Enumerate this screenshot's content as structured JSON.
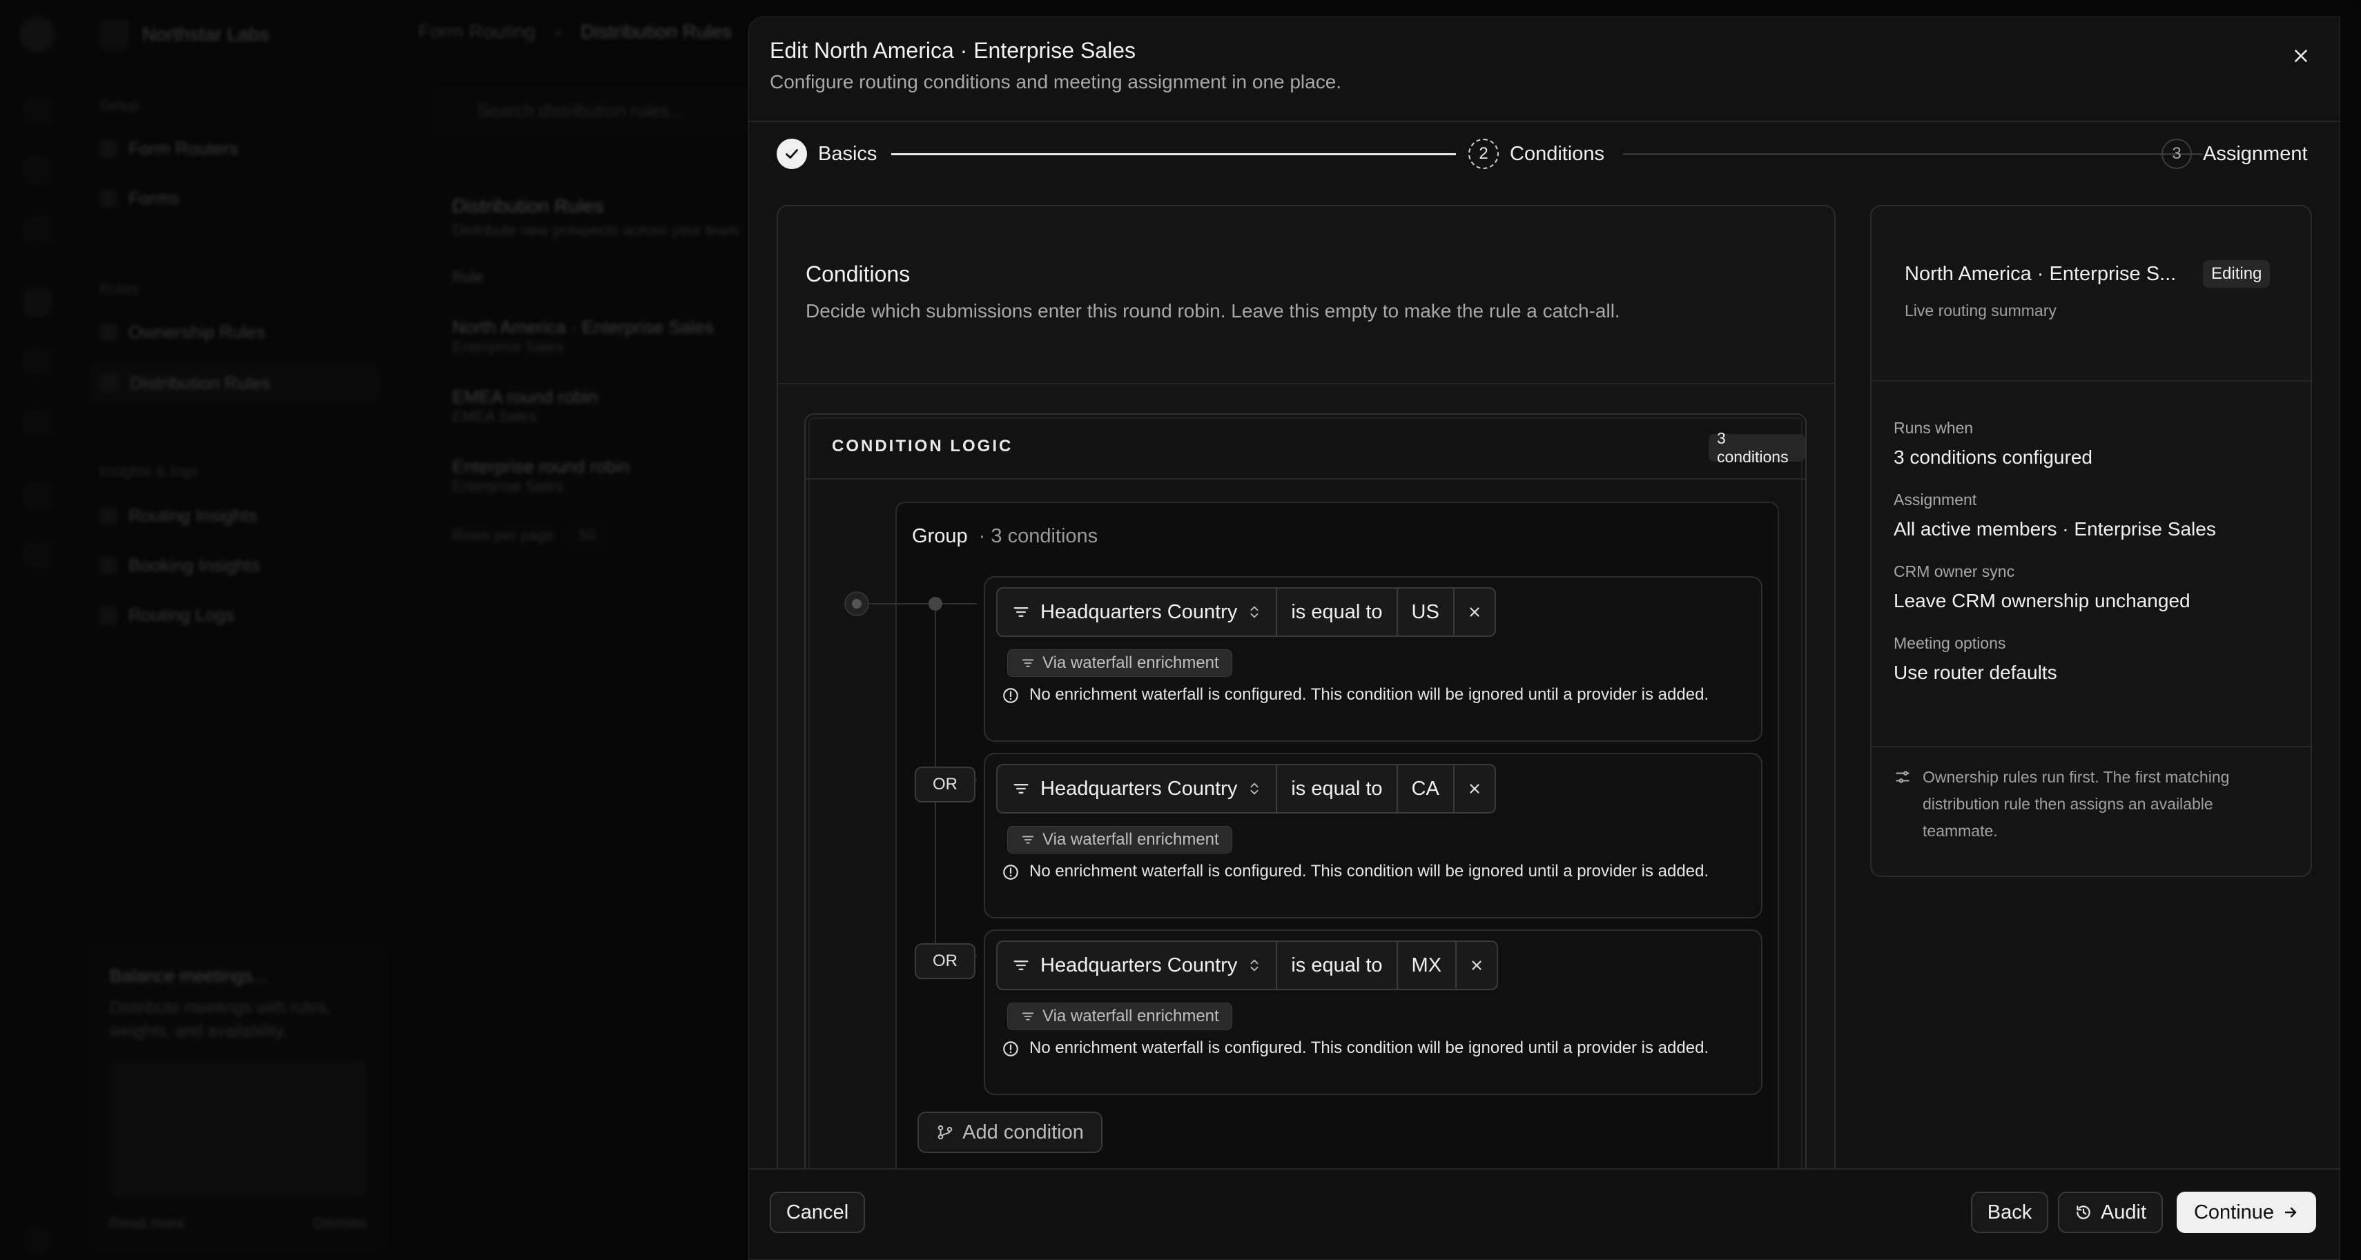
{
  "background": {
    "workspace": "Northstar Labs",
    "breadcrumb": [
      "Form Routing",
      "Distribution Rules"
    ],
    "search_placeholder": "Search distribution rules...",
    "sidebar": {
      "section_setup": "Setup",
      "items_setup": [
        "Form Routers",
        "Forms"
      ],
      "section_rules": "Rules",
      "items_rules": [
        "Ownership Rules",
        "Distribution Rules"
      ],
      "section_insights": "Insights & logs",
      "items_insights": [
        "Routing Insights",
        "Booking Insights",
        "Routing Logs"
      ],
      "promo_title": "Balance meetings...",
      "promo_text": "Distribute meetings with rules, weights, and availability.",
      "promo_link": "Read more",
      "promo_dismiss": "Dismiss"
    },
    "list": {
      "title": "Distribution Rules",
      "subtitle": "Distribute new prospects across your team",
      "filter": "Rule",
      "rows": [
        {
          "name": "North America · Enterprise Sales",
          "team": "Enterprise Sales"
        },
        {
          "name": "EMEA round robin",
          "team": "EMEA Sales"
        },
        {
          "name": "Enterprise round robin",
          "team": "Enterprise Sales"
        }
      ],
      "rows_per_page_label": "Rows per page",
      "rows_per_page": "50"
    }
  },
  "dialog": {
    "title": "Edit North America · Enterprise Sales",
    "subtitle": "Configure routing conditions and meeting assignment in one place.",
    "steps": [
      {
        "num": "1",
        "label": "Basics",
        "state": "done"
      },
      {
        "num": "2",
        "label": "Conditions",
        "state": "current"
      },
      {
        "num": "3",
        "label": "Assignment",
        "state": "upcoming"
      }
    ],
    "conditions": {
      "title": "Conditions",
      "description": "Decide which submissions enter this round robin. Leave this empty to make the rule a catch-all.",
      "logic_title": "CONDITION LOGIC",
      "count_badge": "3 conditions",
      "group_label": "Group",
      "group_count": "· 3 conditions",
      "items": [
        {
          "connector": "",
          "field": "Headquarters Country",
          "operator": "is equal to",
          "value": "US",
          "enrichment": "Via waterfall enrichment",
          "warning": "No enrichment waterfall is configured. This condition will be ignored until a provider is added."
        },
        {
          "connector": "OR",
          "field": "Headquarters Country",
          "operator": "is equal to",
          "value": "CA",
          "enrichment": "Via waterfall enrichment",
          "warning": "No enrichment waterfall is configured. This condition will be ignored until a provider is added."
        },
        {
          "connector": "OR",
          "field": "Headquarters Country",
          "operator": "is equal to",
          "value": "MX",
          "enrichment": "Via waterfall enrichment",
          "warning": "No enrichment waterfall is configured. This condition will be ignored until a provider is added."
        }
      ],
      "add_condition": "Add condition"
    },
    "summary": {
      "title": "North America · Enterprise S...",
      "badge": "Editing",
      "subtitle": "Live routing summary",
      "rows": [
        {
          "label": "Runs when",
          "value": "3 conditions configured"
        },
        {
          "label": "Assignment",
          "value": "All active members · Enterprise Sales"
        },
        {
          "label": "CRM owner sync",
          "value": "Leave CRM ownership unchanged"
        },
        {
          "label": "Meeting options",
          "value": "Use router defaults"
        }
      ],
      "note": "Ownership rules run first. The first matching distribution rule then assigns an available teammate."
    },
    "footer": {
      "cancel": "Cancel",
      "back": "Back",
      "audit": "Audit",
      "continue": "Continue"
    }
  }
}
